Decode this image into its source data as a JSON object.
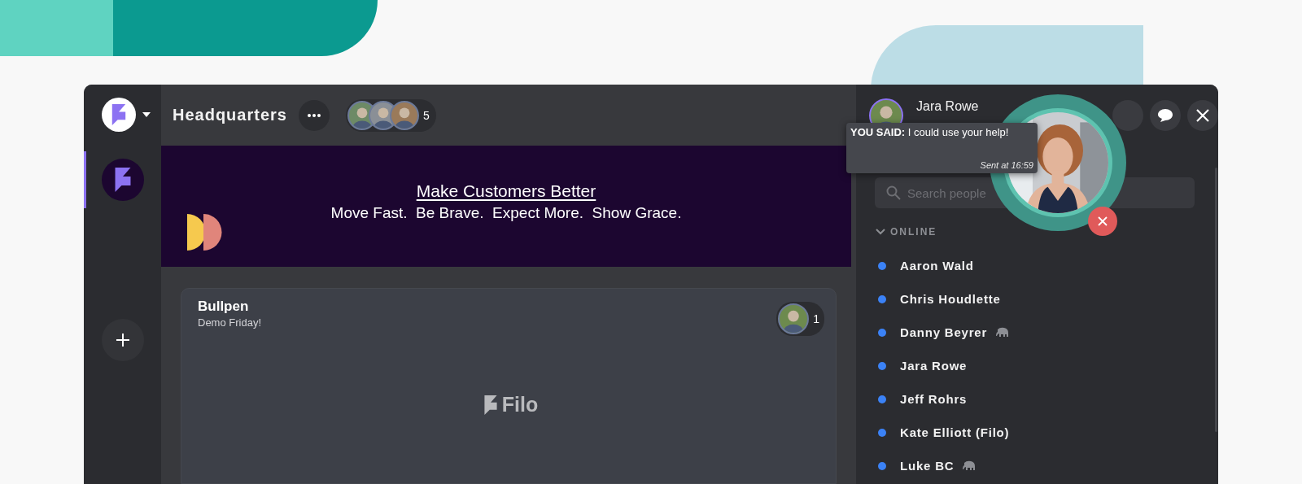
{
  "sidebar": {
    "items": [
      {
        "selected": true
      }
    ]
  },
  "header": {
    "title": "Headquarters",
    "member_count": "5"
  },
  "banner": {
    "title": "Make Customers Better",
    "tagline": "Move Fast.  Be Brave.  Expect More.  Show Grace."
  },
  "room": {
    "name": "Bullpen",
    "subtitle": "Demo Friday!",
    "member_count": "1",
    "logo_text": "Filo"
  },
  "profile": {
    "name": "Jara Rowe"
  },
  "message": {
    "text": "**YOU SAID:** I could use your help!",
    "time": "Sent at 16:59"
  },
  "search": {
    "placeholder": "Search people"
  },
  "people": {
    "section": "ONLINE",
    "expanded": true,
    "members": [
      {
        "name": "Aaron Wald",
        "badge": false
      },
      {
        "name": "Chris Houdlette",
        "badge": false
      },
      {
        "name": "Danny Beyrer",
        "badge": true
      },
      {
        "name": "Jara Rowe",
        "badge": false
      },
      {
        "name": "Jeff Rohrs",
        "badge": false
      },
      {
        "name": "Kate Elliott (Filo)",
        "badge": false
      },
      {
        "name": "Luke BC",
        "badge": true
      }
    ]
  }
}
